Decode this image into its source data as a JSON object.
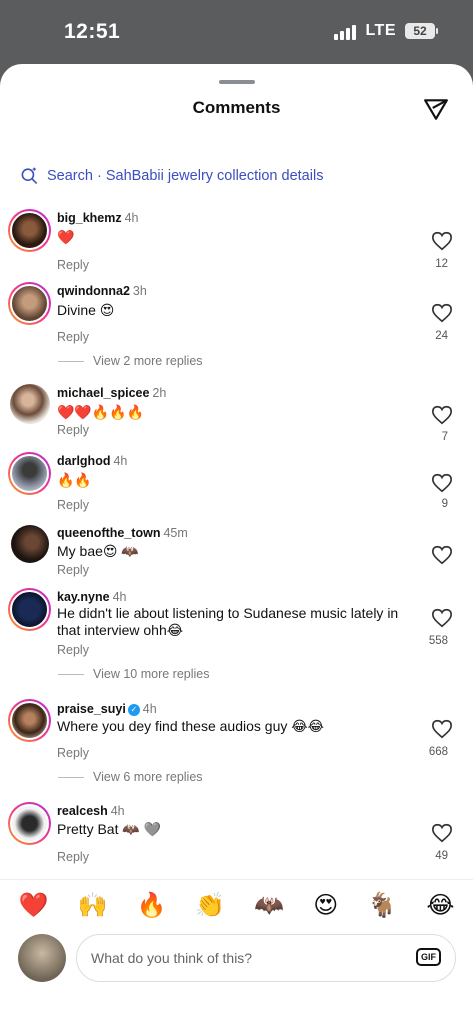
{
  "status": {
    "time": "12:51",
    "network": "LTE",
    "battery": "52"
  },
  "header": {
    "title": "Comments"
  },
  "search": {
    "label": "Search · SahBabii jewelry collection details"
  },
  "comments": [
    {
      "user": "big_khemz",
      "time": "4h",
      "text": "❤️",
      "reply": "Reply",
      "likes": "12",
      "more": ""
    },
    {
      "user": "qwindonna2",
      "time": "3h",
      "text": "Divine 😍",
      "reply": "Reply",
      "likes": "24",
      "more": "View 2 more replies"
    },
    {
      "user": "michael_spicee",
      "time": "2h",
      "text": "❤️❤️🔥🔥🔥",
      "reply": "Reply",
      "likes": "7",
      "more": ""
    },
    {
      "user": "darlghod",
      "time": "4h",
      "text": "🔥🔥",
      "reply": "Reply",
      "likes": "9",
      "more": ""
    },
    {
      "user": "queenofthe_town",
      "time": "45m",
      "text": "My bae😍 🦇",
      "reply": "Reply",
      "likes": "",
      "more": ""
    },
    {
      "user": "kay.nyne",
      "time": "4h",
      "text": "He didn't lie about listening to Sudanese music lately in that interview ohh😂",
      "reply": "Reply",
      "likes": "558",
      "more": "View 10 more replies"
    },
    {
      "user": "praise_suyi",
      "time": "4h",
      "text": "Where you dey find these audios guy 😂😂",
      "reply": "Reply",
      "likes": "668",
      "more": "View 6 more replies"
    },
    {
      "user": "realcesh",
      "time": "4h",
      "text": "Pretty Bat 🦇 🩶",
      "reply": "Reply",
      "likes": "49",
      "more": ""
    }
  ],
  "emoji_bar": [
    "❤️",
    "🙌",
    "🔥",
    "👏",
    "🦇",
    "😍",
    "🐐",
    "😂"
  ],
  "composer": {
    "placeholder": "What do you think of this?",
    "gif_label": "GIF"
  }
}
